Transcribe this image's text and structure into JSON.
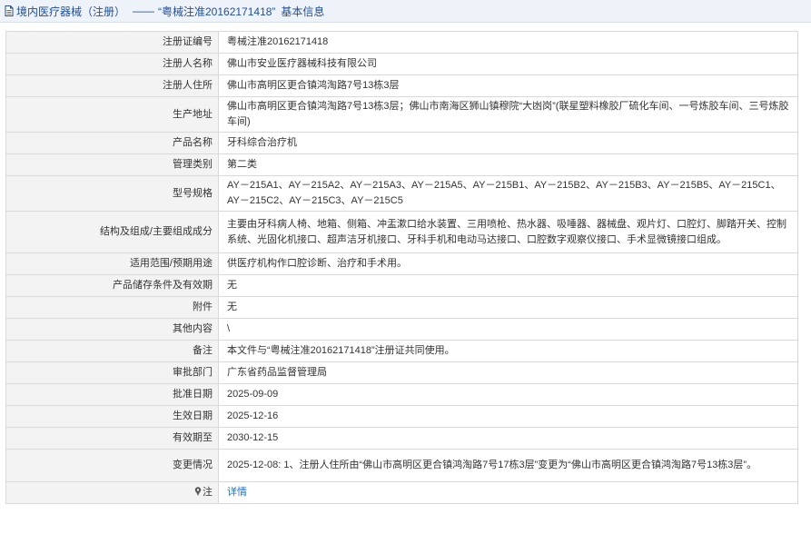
{
  "header": {
    "category": "境内医疗器械（注册）",
    "separator": "——",
    "reg_no_quoted": "“粤械注准20162171418”",
    "suffix": "基本信息"
  },
  "rows": [
    {
      "label": "注册证编号",
      "value": "粤械注准20162171418"
    },
    {
      "label": "注册人名称",
      "value": "佛山市安业医疗器械科技有限公司"
    },
    {
      "label": "注册人住所",
      "value": "佛山市高明区更合镇鸿淘路7号13栋3层"
    },
    {
      "label": "生产地址",
      "value": "佛山市高明区更合镇鸿淘路7号13栋3层；佛山市南海区狮山镇穆院“大凼岗”(联星塑料橡胶厂硫化车间、一号炼胶车间、三号炼胶车间)"
    },
    {
      "label": "产品名称",
      "value": "牙科综合治疗机"
    },
    {
      "label": "管理类别",
      "value": "第二类"
    },
    {
      "label": "型号规格",
      "value": "AY－215A1、AY－215A2、AY－215A3、AY－215A5、AY－215B1、AY－215B2、AY－215B3、AY－215B5、AY－215C1、AY－215C2、AY－215C3、AY－215C5"
    },
    {
      "label": "结构及组成/主要组成成分",
      "value": "主要由牙科病人椅、地箱、侧箱、冲盂漱口给水装置、三用喷枪、热水器、吸唾器、器械盘、观片灯、口腔灯、脚踏开关、控制系统、光固化机接口、超声洁牙机接口、牙科手机和电动马达接口、口腔数字观察仪接口、手术显微镜接口组成。"
    },
    {
      "label": "适用范围/预期用途",
      "value": "供医疗机构作口腔诊断、治疗和手术用。"
    },
    {
      "label": "产品储存条件及有效期",
      "value": "无"
    },
    {
      "label": "附件",
      "value": "无"
    },
    {
      "label": "其他内容",
      "value": "\\"
    },
    {
      "label": "备注",
      "value": "本文件与“粤械注准20162171418”注册证共同使用。"
    },
    {
      "label": "审批部门",
      "value": "广东省药品监督管理局"
    },
    {
      "label": "批准日期",
      "value": "2025-09-09"
    },
    {
      "label": "生效日期",
      "value": "2025-12-16"
    },
    {
      "label": "有效期至",
      "value": "2030-12-15"
    },
    {
      "label": "变更情况",
      "value": "2025-12-08: 1、注册人住所由“佛山市高明区更合镇鸿淘路7号17栋3层”变更为“佛山市高明区更合镇鸿淘路7号13栋3层”。"
    }
  ],
  "note": {
    "label": "注",
    "link_text": "详情",
    "icon": "pin-icon"
  },
  "colors": {
    "header_bg": "#eef2f9",
    "header_text": "#1f4f97",
    "label_bg": "#f3f3f3",
    "border": "#d9d9d9",
    "link": "#1a6fc9"
  }
}
